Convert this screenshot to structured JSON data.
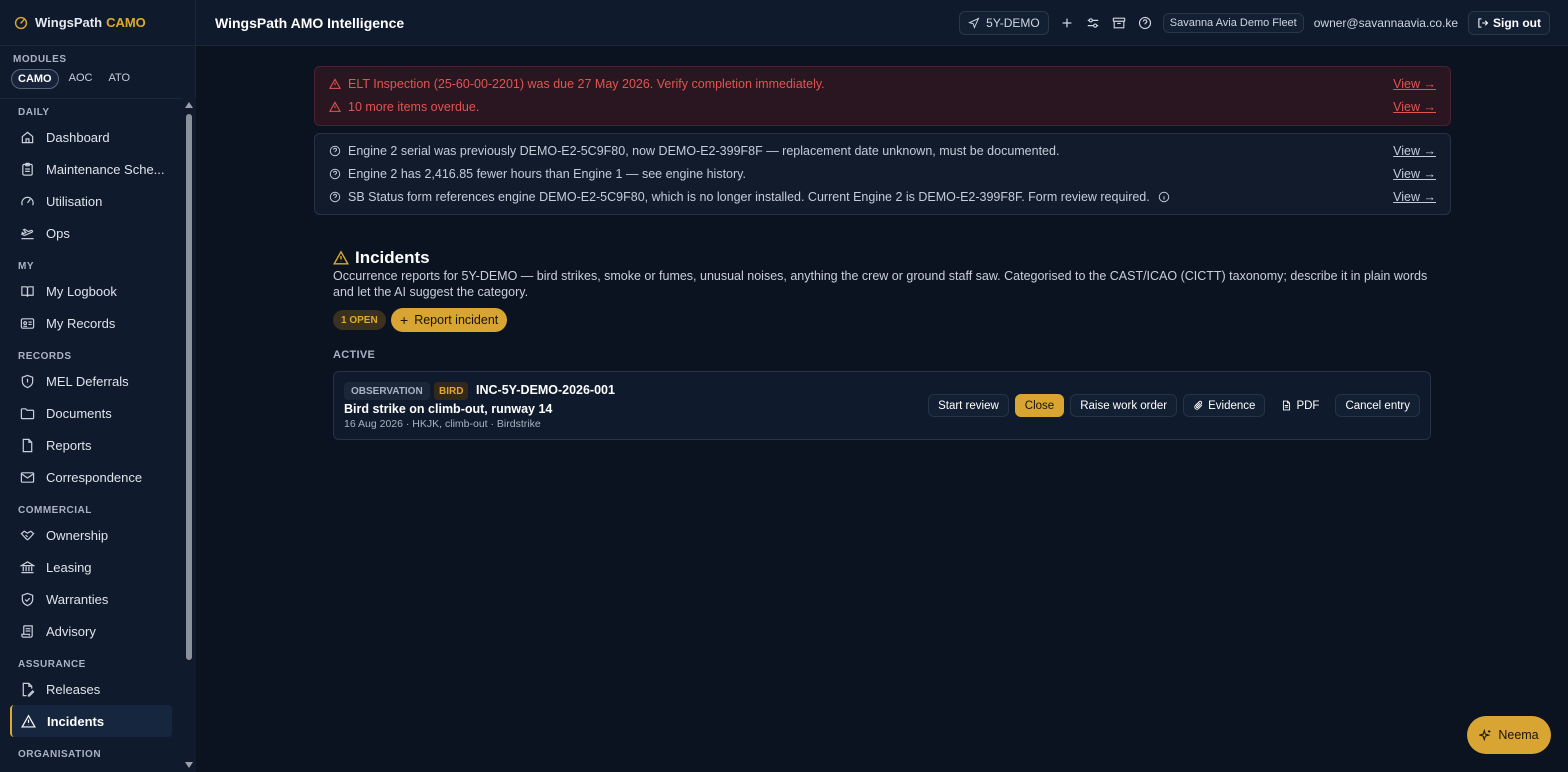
{
  "brand": {
    "name": "WingsPath",
    "accent": "CAMO"
  },
  "modules": {
    "label": "MODULES",
    "tabs": [
      {
        "label": "CAMO",
        "active": true
      },
      {
        "label": "AOC",
        "active": false
      },
      {
        "label": "ATO",
        "active": false
      }
    ]
  },
  "sidebar": {
    "sections": [
      {
        "label": "DAILY",
        "items": [
          {
            "label": "Dashboard",
            "icon": "home-icon"
          },
          {
            "label": "Maintenance Sche...",
            "icon": "clipboard-icon"
          },
          {
            "label": "Utilisation",
            "icon": "gauge-icon"
          },
          {
            "label": "Ops",
            "icon": "plane-takeoff-icon"
          }
        ]
      },
      {
        "label": "MY",
        "items": [
          {
            "label": "My Logbook",
            "icon": "book-icon"
          },
          {
            "label": "My Records",
            "icon": "id-card-icon"
          }
        ]
      },
      {
        "label": "RECORDS",
        "items": [
          {
            "label": "MEL Deferrals",
            "icon": "shield-icon"
          },
          {
            "label": "Documents",
            "icon": "folder-icon"
          },
          {
            "label": "Reports",
            "icon": "file-icon"
          },
          {
            "label": "Correspondence",
            "icon": "mail-icon"
          }
        ]
      },
      {
        "label": "COMMERCIAL",
        "items": [
          {
            "label": "Ownership",
            "icon": "handshake-icon"
          },
          {
            "label": "Leasing",
            "icon": "bank-icon"
          },
          {
            "label": "Warranties",
            "icon": "shield-check-icon"
          },
          {
            "label": "Advisory",
            "icon": "scroll-icon"
          }
        ]
      },
      {
        "label": "ASSURANCE",
        "items": [
          {
            "label": "Releases",
            "icon": "file-sign-icon"
          },
          {
            "label": "Incidents",
            "icon": "warning-icon",
            "active": true
          }
        ]
      },
      {
        "label": "ORGANISATION",
        "items": []
      }
    ]
  },
  "header": {
    "title": "WingsPath AMO Intelligence",
    "aircraft": "5Y-DEMO",
    "fleet": "Savanna Avia Demo Fleet",
    "user_email": "owner@savannaavia.co.ke",
    "signout": "Sign out"
  },
  "alerts_red": [
    {
      "text": "ELT Inspection (25-60-00-2201) was due 27 May 2026. Verify completion immediately.",
      "link": "View →"
    },
    {
      "text": "10 more items overdue.",
      "link": "View →"
    }
  ],
  "alerts_info": [
    {
      "text": "Engine 2 serial was previously DEMO-E2-5C9F80, now DEMO-E2-399F8F — replacement date unknown, must be documented.",
      "link": "View →"
    },
    {
      "text": "Engine 2 has 2,416.85 fewer hours than Engine 1 — see engine history.",
      "link": "View →"
    },
    {
      "text": "SB Status form references engine DEMO-E2-5C9F80, which is no longer installed. Current Engine 2 is DEMO-E2-399F8F. Form review required.",
      "link": "View →"
    }
  ],
  "incidents": {
    "title": "Incidents",
    "description": "Occurrence reports for 5Y-DEMO — bird strikes, smoke or fumes, unusual noises, anything the crew or ground staff saw. Categorised to the CAST/ICAO (CICTT) taxonomy; describe it in plain words and let the AI suggest the category.",
    "open_badge": "1 OPEN",
    "report_button": "Report incident",
    "active_label": "ACTIVE",
    "card": {
      "type": "OBSERVATION",
      "category": "BIRD",
      "ref": "INC-5Y-DEMO-2026-001",
      "name": "Bird strike on climb-out, runway 14",
      "meta": "16 Aug 2026 · HKJK, climb-out · Birdstrike",
      "actions": {
        "start_review": "Start review",
        "close": "Close",
        "raise_wo": "Raise work order",
        "evidence": "Evidence",
        "pdf": "PDF",
        "cancel": "Cancel entry"
      }
    }
  },
  "assistant": {
    "label": "Neema"
  },
  "colors": {
    "accent": "#e0a92e",
    "danger": "#e2544f",
    "background": "#0b1220"
  }
}
